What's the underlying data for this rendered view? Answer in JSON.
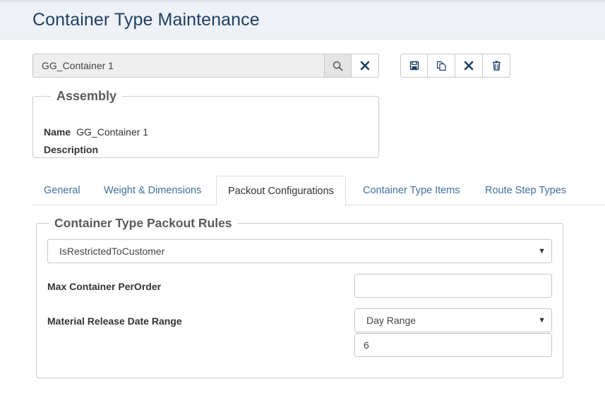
{
  "header": {
    "title": "Container Type Maintenance"
  },
  "search": {
    "value": "GG_Container 1"
  },
  "assembly": {
    "legend": "Assembly",
    "name_label": "Name",
    "name_value": "GG_Container 1",
    "description_label": "Description",
    "description_value": ""
  },
  "tabs": [
    {
      "label": "General"
    },
    {
      "label": "Weight & Dimensions"
    },
    {
      "label": "Packout Configurations",
      "active": true
    },
    {
      "label": "Container Type Items"
    },
    {
      "label": "Route Step Types"
    }
  ],
  "rules": {
    "legend": "Container Type Packout Rules",
    "restriction_select": "IsRestrictedToCustomer",
    "max_container_label": "Max Container PerOrder",
    "max_container_value": "",
    "release_range_label": "Material Release Date Range",
    "release_range_select": "Day Range",
    "release_range_value": "6"
  },
  "colors": {
    "title": "#1f3f66",
    "tab_link": "#3f6fa0",
    "header_bg": "#eef1f5"
  }
}
